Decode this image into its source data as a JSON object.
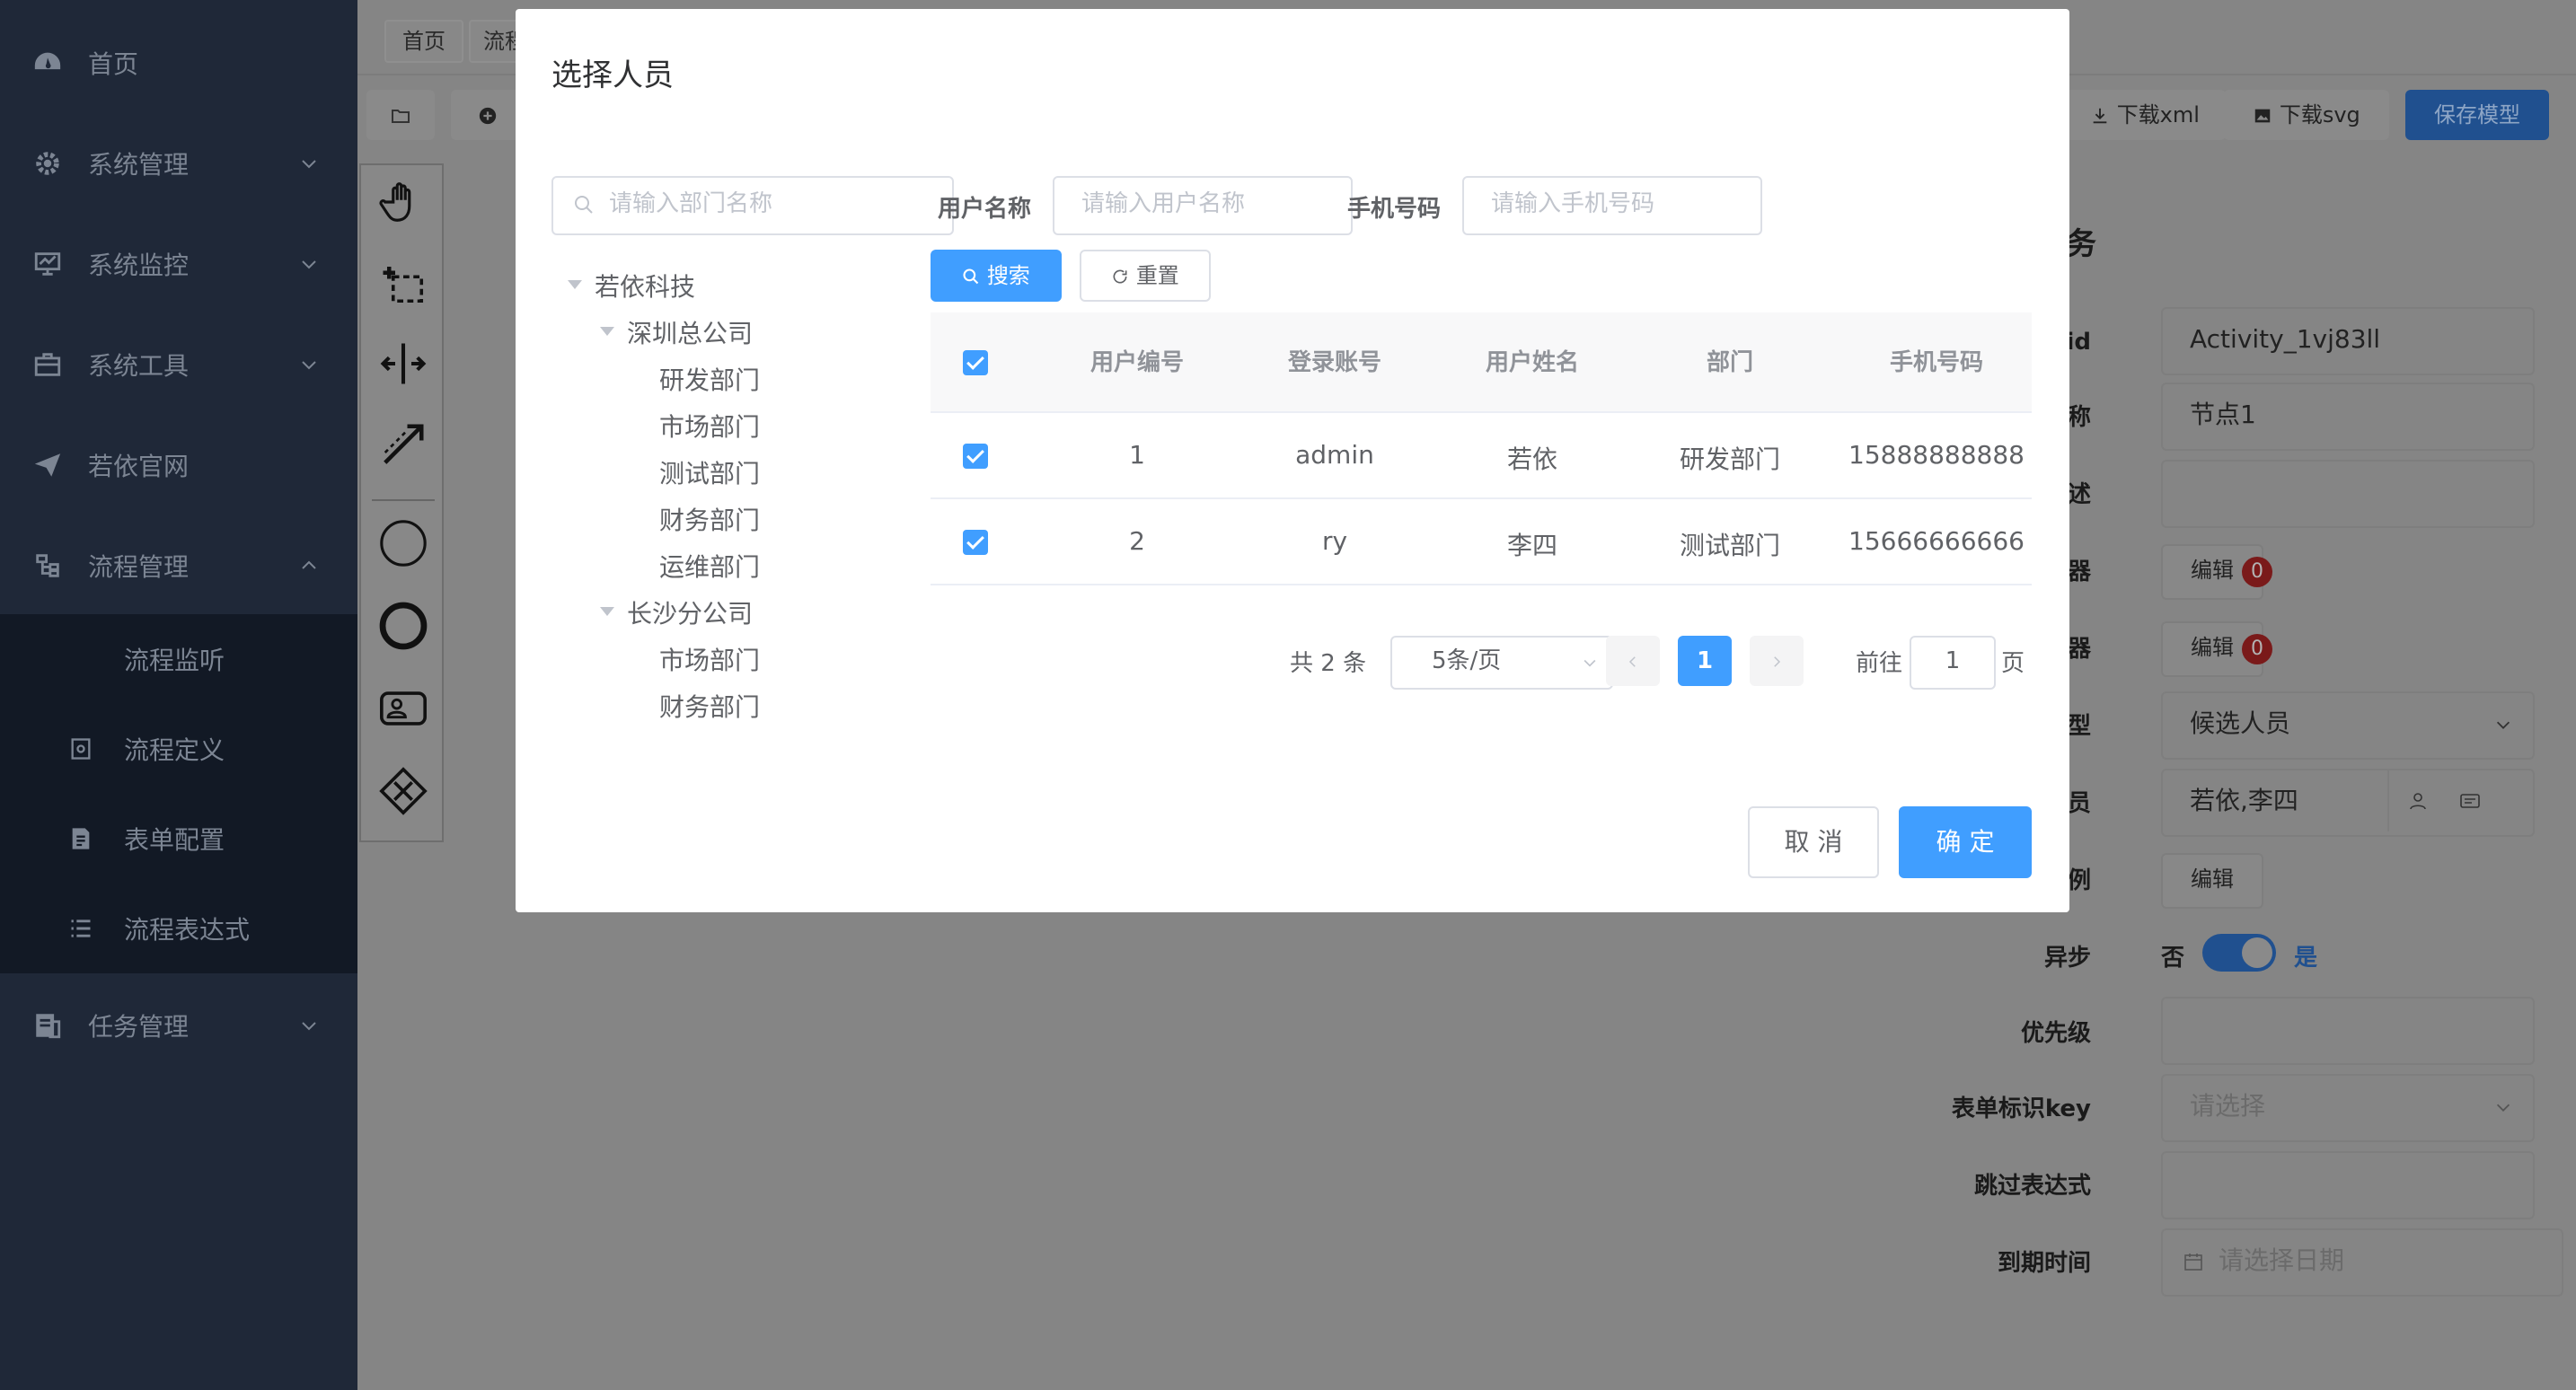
{
  "sidebar": {
    "items": [
      {
        "label": "首页",
        "icon": "dashboard-icon"
      },
      {
        "label": "系统管理",
        "icon": "gear-icon"
      },
      {
        "label": "系统监控",
        "icon": "monitor-icon"
      },
      {
        "label": "系统工具",
        "icon": "toolbox-icon"
      },
      {
        "label": "若依官网",
        "icon": "paper-plane-icon"
      },
      {
        "label": "流程管理",
        "icon": "tree-icon"
      },
      {
        "label": "任务管理",
        "icon": "task-icon"
      }
    ],
    "sub_items": [
      {
        "label": "流程监听"
      },
      {
        "label": "流程定义",
        "icon": "definition-icon"
      },
      {
        "label": "表单配置",
        "icon": "form-icon"
      },
      {
        "label": "流程表达式",
        "icon": "list-icon"
      }
    ]
  },
  "tabs": [
    "首页",
    "流程"
  ],
  "toolbar": {
    "download_xml": "下载xml",
    "download_svg": "下载svg",
    "save_model": "保存模型"
  },
  "properties": {
    "section_title": "务",
    "rows": [
      {
        "label": "节点 id",
        "value": "Activity_1vj83ll"
      },
      {
        "label": "点名称",
        "value": "节点1"
      },
      {
        "label": "点描述",
        "value": ""
      },
      {
        "label": "监听器",
        "button": "编辑",
        "badge": "0"
      },
      {
        "label": "监听器",
        "button": "编辑",
        "badge": "0"
      },
      {
        "label": "户类型",
        "value": "候选人员"
      },
      {
        "label": "选人员",
        "value": "若依,李四"
      },
      {
        "label": "多实例",
        "button": "编辑"
      },
      {
        "label": "异步",
        "off": "否",
        "on": "是"
      },
      {
        "label": "优先级",
        "value": ""
      },
      {
        "label": "表单标识key",
        "placeholder": "请选择"
      },
      {
        "label": "跳过表达式",
        "value": ""
      },
      {
        "label": "到期时间",
        "placeholder": "请选择日期"
      }
    ]
  },
  "dialog": {
    "title": "选择人员",
    "dept_search_placeholder": "请输入部门名称",
    "tree": [
      {
        "label": "若依科技",
        "level": 0,
        "expanded": true
      },
      {
        "label": "深圳总公司",
        "level": 1,
        "expanded": true
      },
      {
        "label": "研发部门",
        "level": 2
      },
      {
        "label": "市场部门",
        "level": 2
      },
      {
        "label": "测试部门",
        "level": 2
      },
      {
        "label": "财务部门",
        "level": 2
      },
      {
        "label": "运维部门",
        "level": 2
      },
      {
        "label": "长沙分公司",
        "level": 1,
        "expanded": true
      },
      {
        "label": "市场部门",
        "level": 2
      },
      {
        "label": "财务部门",
        "level": 2
      }
    ],
    "filters": {
      "username_label": "用户名称",
      "username_placeholder": "请输入用户名称",
      "phone_label": "手机号码",
      "phone_placeholder": "请输入手机号码"
    },
    "search_button": "搜索",
    "reset_button": "重置",
    "table": {
      "headers": [
        "用户编号",
        "登录账号",
        "用户姓名",
        "部门",
        "手机号码"
      ],
      "rows": [
        {
          "id": "1",
          "account": "admin",
          "name": "若依",
          "dept": "研发部门",
          "phone": "15888888888"
        },
        {
          "id": "2",
          "account": "ry",
          "name": "李四",
          "dept": "测试部门",
          "phone": "15666666666"
        }
      ]
    },
    "pagination": {
      "total": "共 2 条",
      "page_size": "5条/页",
      "current": "1",
      "goto_label": "前往",
      "goto_value": "1",
      "page_suffix": "页"
    },
    "cancel": "取 消",
    "confirm": "确 定"
  }
}
